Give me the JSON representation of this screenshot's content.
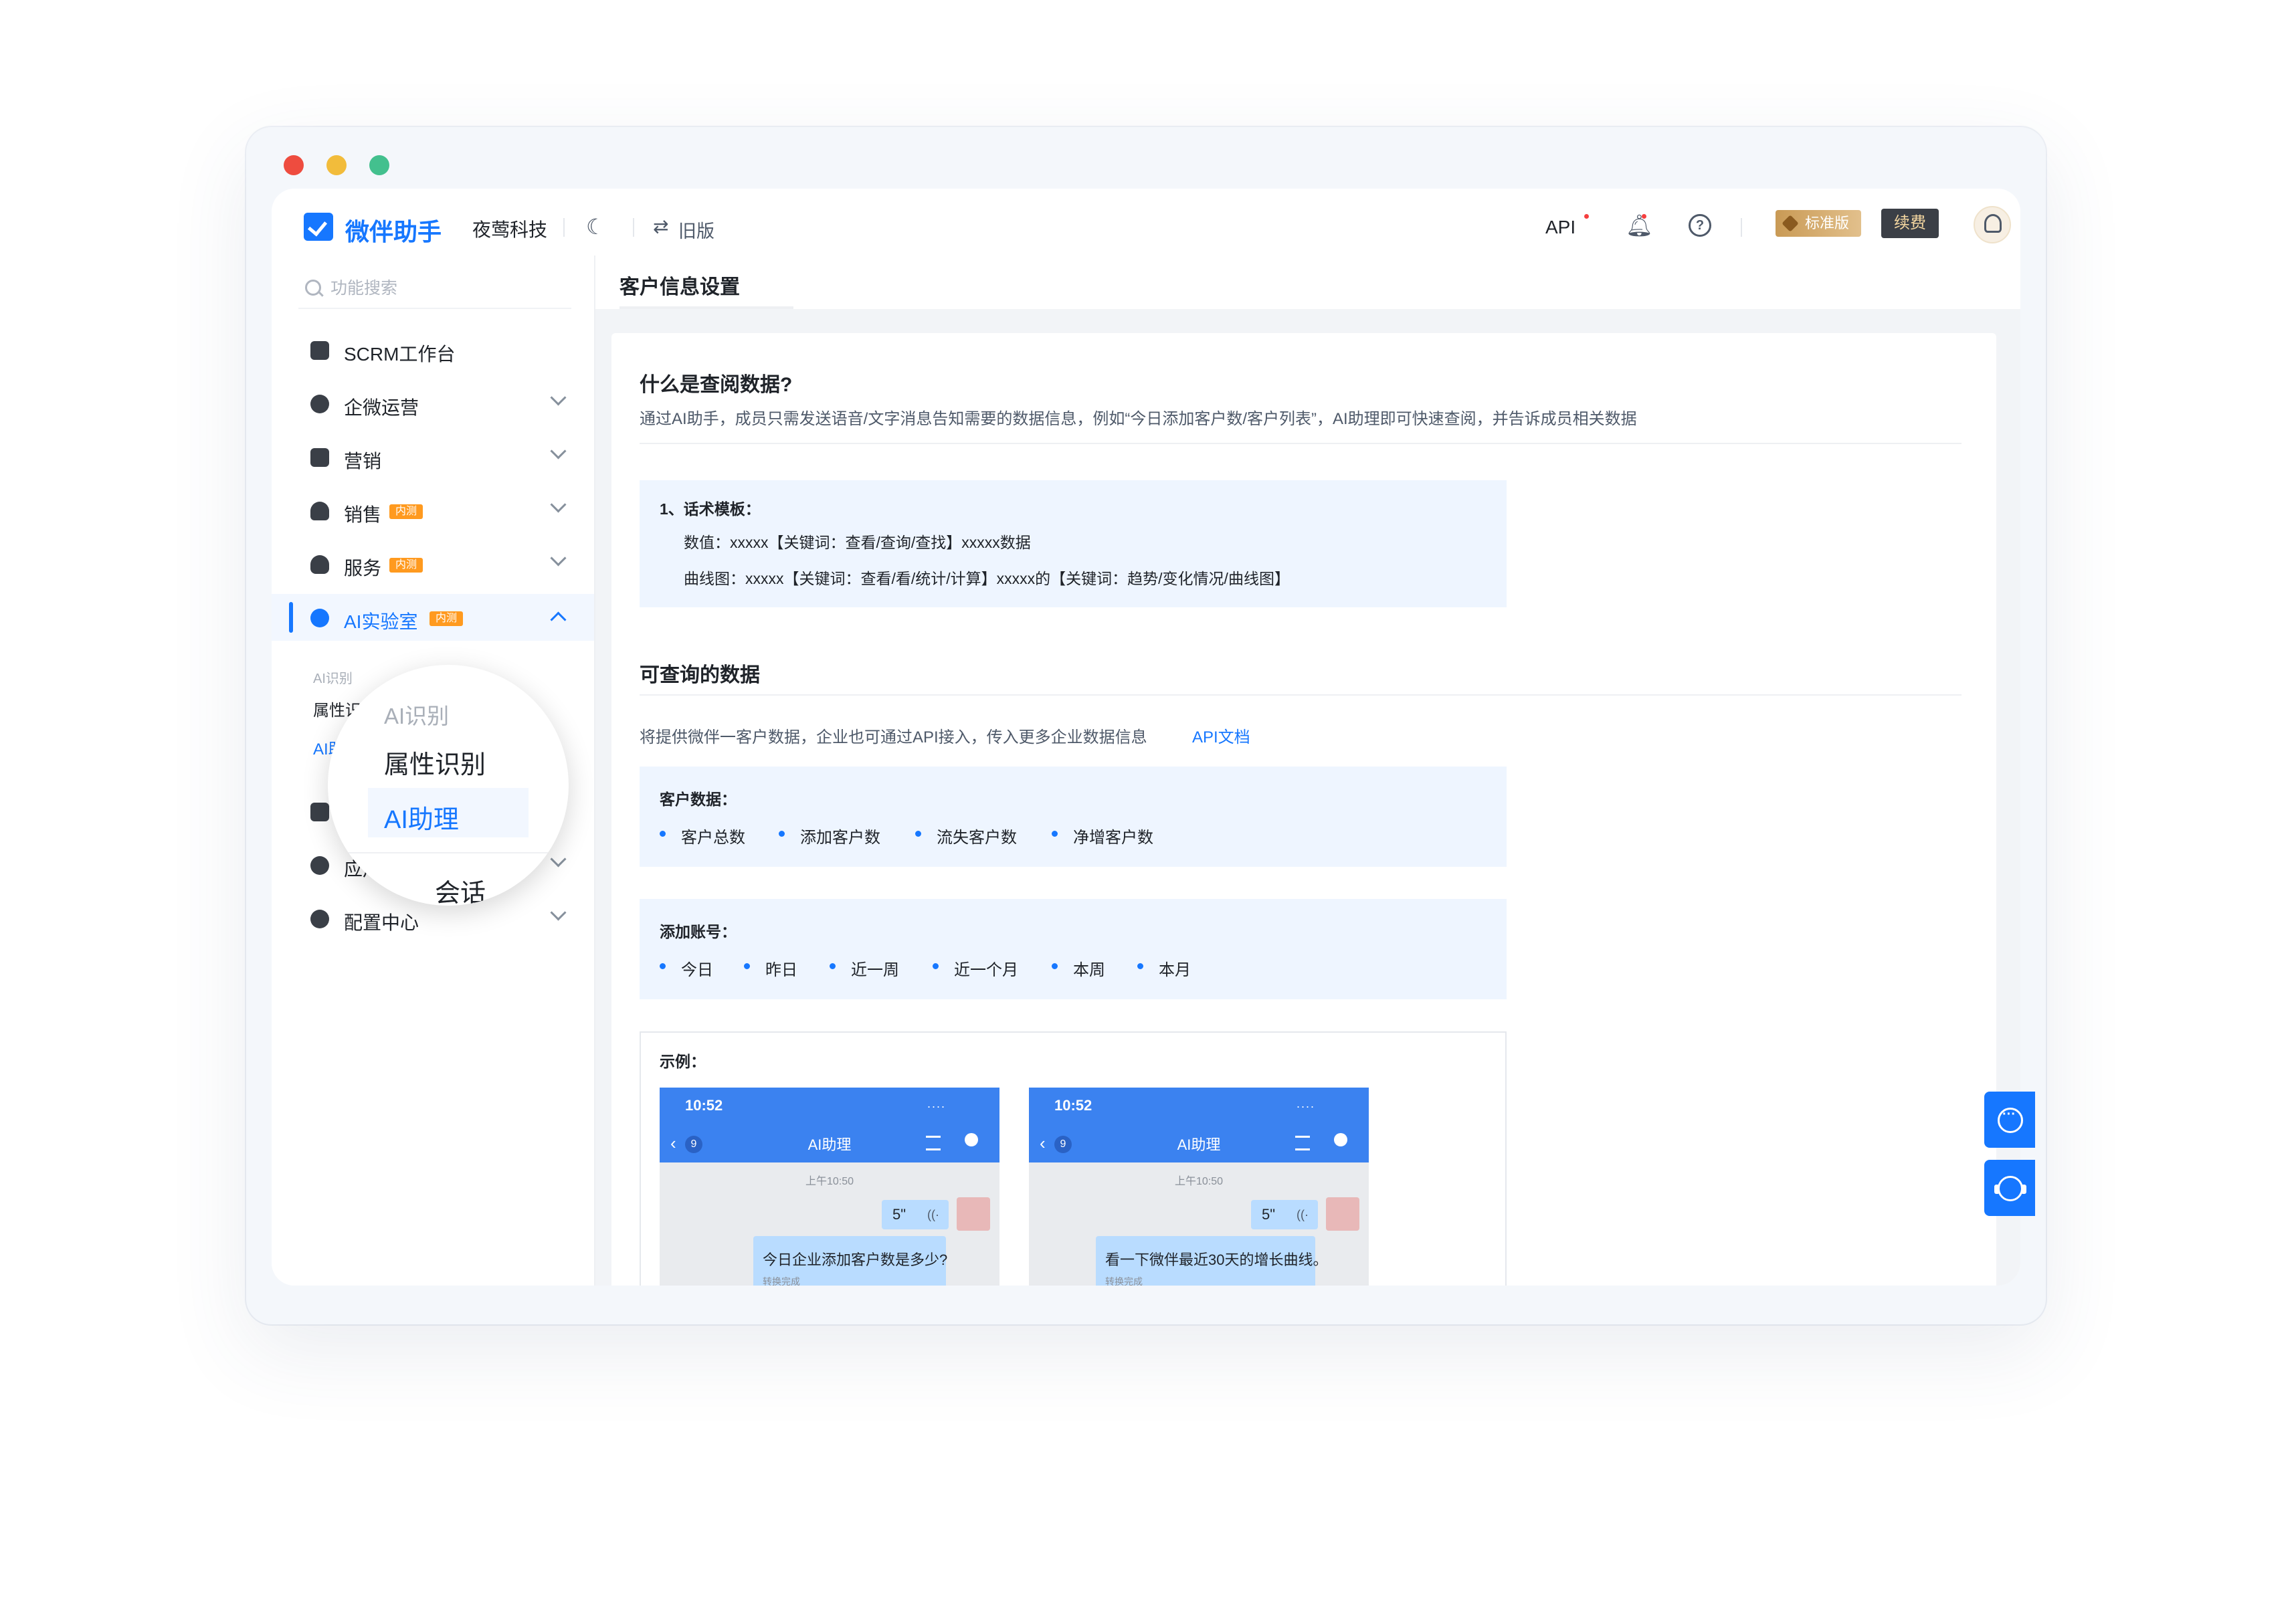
{
  "window": {
    "controls": [
      "close",
      "minimize",
      "maximize"
    ]
  },
  "header": {
    "brand": "微伴助手",
    "company": "夜莺科技",
    "old_version": "旧版",
    "api": "API",
    "edition_badge": "标准版",
    "renew": "续费"
  },
  "sidebar": {
    "search_placeholder": "功能搜索",
    "items": [
      {
        "label": "SCRM工作台",
        "icon": "monitor-icon"
      },
      {
        "label": "企微运营",
        "icon": "chat-bubble-icon"
      },
      {
        "label": "营销",
        "icon": "marketing-icon"
      },
      {
        "label": "销售",
        "icon": "user-group-icon",
        "tag": "内测"
      },
      {
        "label": "服务",
        "icon": "heart-hand-icon",
        "tag": "内测"
      },
      {
        "label": "AI实验室",
        "icon": "ai-icon",
        "tag": "内测"
      },
      {
        "label": "会",
        "icon": "session-icon"
      },
      {
        "label": "应用中心",
        "icon": "apps-icon"
      },
      {
        "label": "配置中心",
        "icon": "gear-icon"
      }
    ],
    "ai_sub": {
      "group_label": "AI识别",
      "item1": "属性识",
      "item2": "AI助理"
    }
  },
  "magnifier": {
    "group_label": "AI识别",
    "item1": "属性识别",
    "item2": "AI助理",
    "item3": "会话"
  },
  "main": {
    "page_title": "客户信息设置",
    "section1_title": "什么是查阅数据?",
    "section1_intro": "通过AI助手，成员只需发送语音/文字消息告知需要的数据信息，例如“今日添加客户数/客户列表”，AI助理即可快速查阅，并告诉成员相关数据",
    "template_title": "1、话术模板：",
    "template_line1": "数值：xxxxx【关键词：查看/查询/查找】xxxxx数据",
    "template_line2": "曲线图：xxxxx【关键词：查看/看/统计/计算】xxxxx的【关键词：趋势/变化情况/曲线图】",
    "section2_title": "可查询的数据",
    "section2_desc": "将提供微伴一客户数据，企业也可通过API接入，传入更多企业数据信息",
    "api_doc_link": "API文档",
    "customer_data_title": "客户数据：",
    "customer_data_items": [
      "客户总数",
      "添加客户数",
      "流失客户数",
      "净增客户数"
    ],
    "account_title": "添加账号：",
    "account_items": [
      "今日",
      "昨日",
      "近一周",
      "近一个月",
      "本周",
      "本月"
    ],
    "example_title": "示例：",
    "phones": [
      {
        "time": "10:52",
        "status": "....",
        "back_count": "9",
        "title": "AI助理",
        "stamp": "上午10:50",
        "voice_duration": "5\"",
        "message": "今日企业添加客户数是多少?",
        "note": "转换完成"
      },
      {
        "time": "10:52",
        "status": "....",
        "back_count": "9",
        "title": "AI助理",
        "stamp": "上午10:50",
        "voice_duration": "5\"",
        "message": "看一下微伴最近30天的增长曲线。",
        "note": "转换完成"
      }
    ]
  },
  "floating": {
    "chat_icon": "chat-icon",
    "service_icon": "headset-icon"
  }
}
